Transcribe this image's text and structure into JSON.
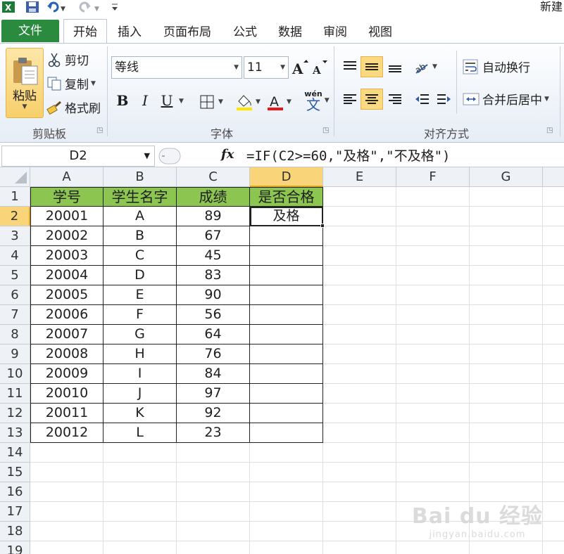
{
  "title": "新建",
  "tabs": {
    "file": "文件",
    "items": [
      "开始",
      "插入",
      "页面布局",
      "公式",
      "数据",
      "审阅",
      "视图"
    ]
  },
  "ribbon": {
    "clipboard": {
      "paste": "粘贴",
      "cut": "剪切",
      "copy": "复制",
      "format_painter": "格式刷",
      "label": "剪贴板"
    },
    "font": {
      "name": "等线",
      "size": "11",
      "bold": "B",
      "italic": "I",
      "underline": "U",
      "label": "字体",
      "phonetic": "wén",
      "phonetic_char": "文"
    },
    "alignment": {
      "wrap_text": "自动换行",
      "merge_center": "合并后居中",
      "label": "对齐方式"
    }
  },
  "formula_bar": {
    "name_box": "D2",
    "fx": "fx",
    "formula": "=IF(C2>=60,\"及格\",\"不及格\")"
  },
  "grid": {
    "columns": [
      "A",
      "B",
      "C",
      "D",
      "E",
      "F",
      "G"
    ],
    "rows": [
      "1",
      "2",
      "3",
      "4",
      "5",
      "6",
      "7",
      "8",
      "9",
      "10",
      "11",
      "12",
      "13",
      "14",
      "15",
      "16",
      "17",
      "18",
      "19"
    ],
    "active_cell": "D2",
    "header_row": [
      "学号",
      "学生名字",
      "成绩",
      "是否合格"
    ],
    "data_rows": [
      [
        "20001",
        "A",
        "89",
        "及格"
      ],
      [
        "20002",
        "B",
        "67",
        ""
      ],
      [
        "20003",
        "C",
        "45",
        ""
      ],
      [
        "20004",
        "D",
        "83",
        ""
      ],
      [
        "20005",
        "E",
        "90",
        ""
      ],
      [
        "20006",
        "F",
        "56",
        ""
      ],
      [
        "20007",
        "G",
        "64",
        ""
      ],
      [
        "20008",
        "H",
        "76",
        ""
      ],
      [
        "20009",
        "I",
        "84",
        ""
      ],
      [
        "20010",
        "J",
        "97",
        ""
      ],
      [
        "20011",
        "K",
        "92",
        ""
      ],
      [
        "20012",
        "L",
        "23",
        ""
      ]
    ]
  },
  "watermark": {
    "brand": "Bai du 经验",
    "url": "jingyan.baidu.com"
  },
  "colors": {
    "header_fill": "#8cc54f",
    "file_tab": "#2a8a3e",
    "selection": "#f9d479"
  }
}
